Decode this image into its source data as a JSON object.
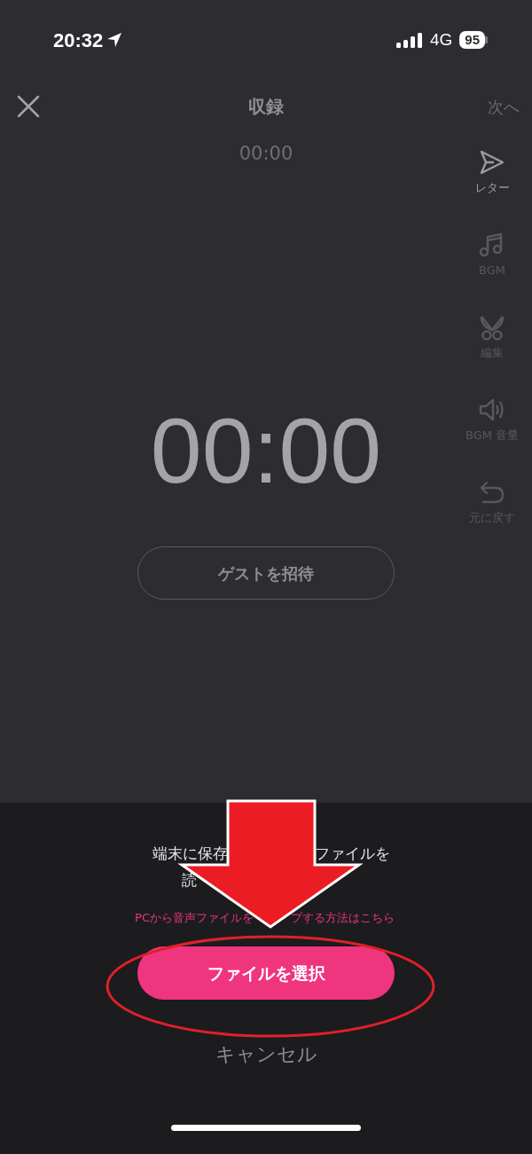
{
  "status_bar": {
    "time": "20:32",
    "network": "4G",
    "battery": "95"
  },
  "header": {
    "title": "収録",
    "next": {
      "label": "次へ",
      "disabled": true
    }
  },
  "elapsed": "00:00",
  "timer": "00:00",
  "guest_button": "ゲストを招待",
  "tools": [
    {
      "kind": "letter",
      "label": "レター",
      "disabled": false
    },
    {
      "kind": "music",
      "label": "BGM",
      "disabled": true
    },
    {
      "kind": "cut",
      "label": "編集",
      "disabled": true
    },
    {
      "kind": "volume",
      "label": "BGM 音量",
      "disabled": true
    },
    {
      "kind": "undo",
      "label": "元に戻す",
      "disabled": true
    }
  ],
  "sheet": {
    "message_lines": [
      [
        "端末に保存",
        "ファイルを"
      ],
      [
        "読"
      ]
    ],
    "link": [
      "PCから音声ファイルを",
      "プする方法はこちら"
    ],
    "primary_button": "ファイルを選択",
    "cancel": "キャンセル"
  }
}
